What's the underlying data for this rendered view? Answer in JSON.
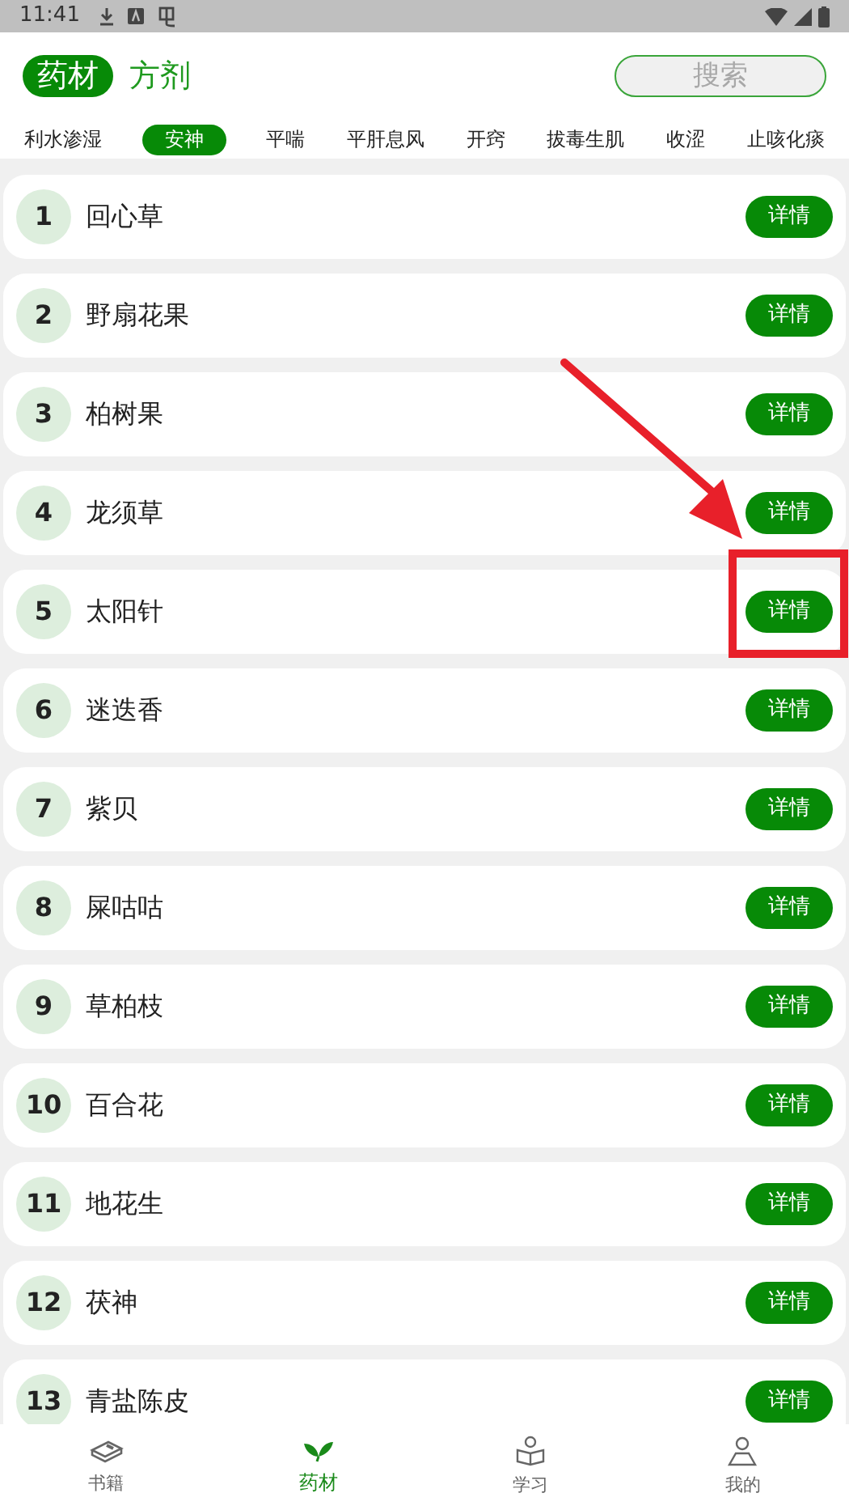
{
  "status_bar": {
    "time": "11:41"
  },
  "mode_tabs": [
    {
      "label": "药材",
      "selected": true
    },
    {
      "label": "方剂",
      "selected": false
    }
  ],
  "search": {
    "placeholder": "搜索"
  },
  "categories": [
    {
      "label": "利水渗湿",
      "selected": false
    },
    {
      "label": "安神",
      "selected": true
    },
    {
      "label": "平喘",
      "selected": false
    },
    {
      "label": "平肝息风",
      "selected": false
    },
    {
      "label": "开窍",
      "selected": false
    },
    {
      "label": "拔毒生肌",
      "selected": false
    },
    {
      "label": "收涩",
      "selected": false
    },
    {
      "label": "止咳化痰",
      "selected": false
    }
  ],
  "items": [
    {
      "number": "1",
      "name": "回心草",
      "button": "详情"
    },
    {
      "number": "2",
      "name": "野扇花果",
      "button": "详情"
    },
    {
      "number": "3",
      "name": "柏树果",
      "button": "详情"
    },
    {
      "number": "4",
      "name": "龙须草",
      "button": "详情"
    },
    {
      "number": "5",
      "name": "太阳针",
      "button": "详情"
    },
    {
      "number": "6",
      "name": "迷迭香",
      "button": "详情"
    },
    {
      "number": "7",
      "name": "紫贝",
      "button": "详情"
    },
    {
      "number": "8",
      "name": "屎咕咕",
      "button": "详情"
    },
    {
      "number": "9",
      "name": "草柏枝",
      "button": "详情"
    },
    {
      "number": "10",
      "name": "百合花",
      "button": "详情"
    },
    {
      "number": "11",
      "name": "地花生",
      "button": "详情"
    },
    {
      "number": "12",
      "name": "茯神",
      "button": "详情"
    },
    {
      "number": "13",
      "name": "青盐陈皮",
      "button": "详情"
    }
  ],
  "bottom_nav": [
    {
      "label": "书籍",
      "kind": "book",
      "selected": false
    },
    {
      "label": "药材",
      "kind": "leaf",
      "selected": true
    },
    {
      "label": "学习",
      "kind": "reader",
      "selected": false
    },
    {
      "label": "我的",
      "kind": "person",
      "selected": false
    }
  ]
}
